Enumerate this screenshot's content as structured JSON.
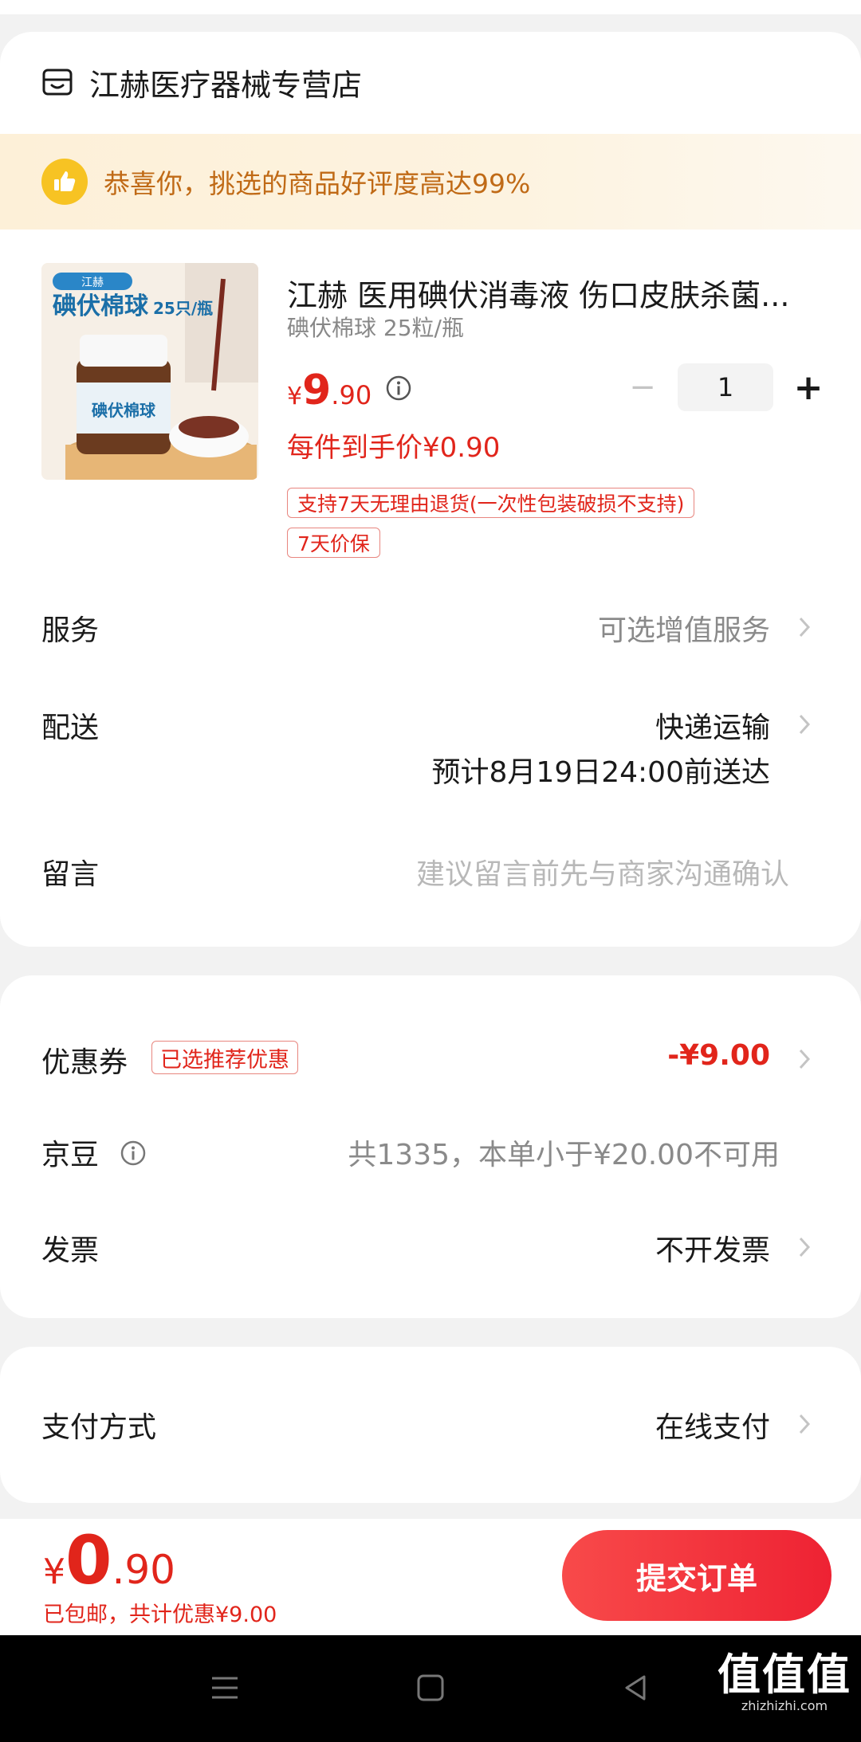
{
  "store": {
    "name": "江赫医疗器械专营店"
  },
  "banner": {
    "text": "恭喜你，挑选的商品好评度高达99%"
  },
  "product": {
    "image_caption": "碘伏棉球",
    "image_count": "25只/瓶",
    "image_brand": "江赫",
    "title": "江赫 医用碘伏消毒液 伤口皮肤杀菌...",
    "spec": "碘伏棉球 25粒/瓶",
    "price_symbol": "¥",
    "price_int": "9",
    "price_dec": ".90",
    "quantity": "1",
    "quantity_minus": "−",
    "quantity_plus": "+",
    "unit_price": "每件到手价¥0.90",
    "tags": [
      "支持7天无理由退货(一次性包装破损不支持)",
      "7天价保"
    ]
  },
  "rows": {
    "service": {
      "label": "服务",
      "value": "可选增值服务"
    },
    "delivery": {
      "label": "配送",
      "value": "快递运输",
      "eta": "预计8月19日24:00前送达"
    },
    "message": {
      "label": "留言",
      "placeholder": "建议留言前先与商家沟通确认"
    }
  },
  "discount": {
    "coupon": {
      "label": "优惠券",
      "tag": "已选推荐优惠",
      "value": "-¥9.00"
    },
    "beans": {
      "label": "京豆",
      "value": "共1335，本单小于¥20.00不可用"
    },
    "invoice": {
      "label": "发票",
      "value": "不开发票"
    }
  },
  "payment": {
    "label": "支付方式",
    "value": "在线支付"
  },
  "footer": {
    "total_symbol": "¥",
    "total_int": "0",
    "total_dec": ".90",
    "shipping": "已包邮",
    "savings": "，共计优惠¥9.00",
    "submit": "提交订单"
  },
  "watermark": {
    "big": "值值值",
    "small": "zhizhizhi.com"
  },
  "colors": {
    "accent": "#e1251b",
    "banner_text": "#c06a16",
    "button": "#f23a3f"
  },
  "icons": [
    "store-icon",
    "thumbs-up-icon",
    "info-icon",
    "chevron-right-icon",
    "menu-icon",
    "home-icon",
    "back-icon"
  ]
}
